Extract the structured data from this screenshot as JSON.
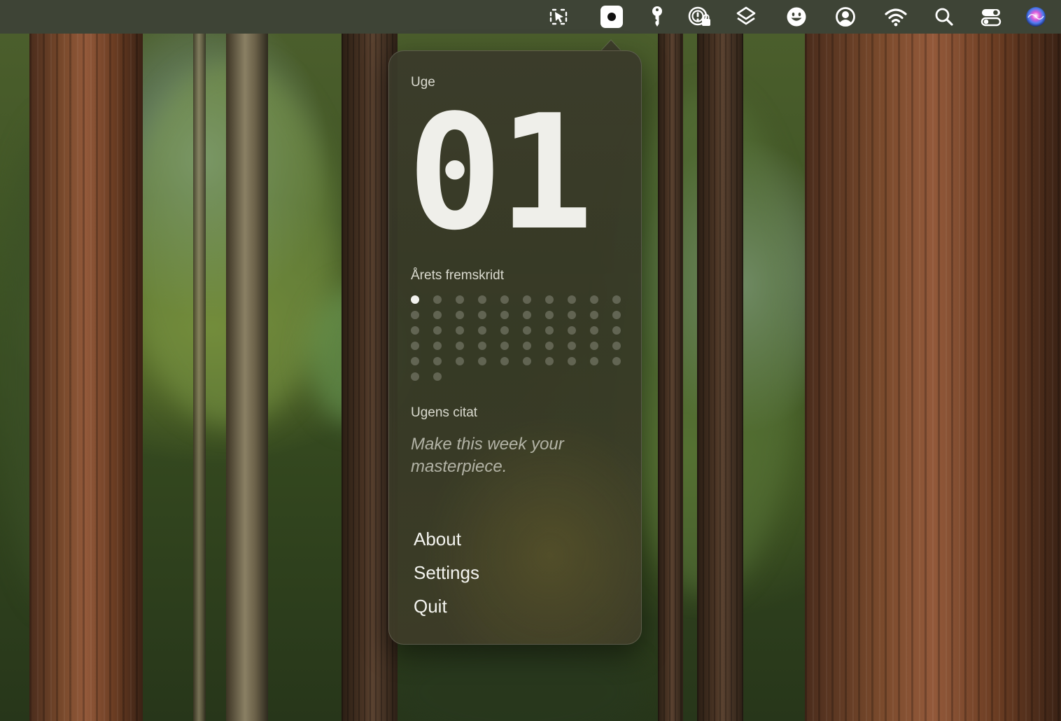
{
  "menubar": {
    "items": [
      {
        "icon": "dev-tool-icon",
        "active": false
      },
      {
        "icon": "record-dot-icon",
        "active": true
      },
      {
        "icon": "key-icon",
        "active": false
      },
      {
        "icon": "alert-lock-icon",
        "active": false
      },
      {
        "icon": "stack-layers-icon",
        "active": false
      },
      {
        "icon": "smiley-icon",
        "active": false
      },
      {
        "icon": "user-circle-icon",
        "active": false
      },
      {
        "icon": "wifi-icon",
        "active": false
      },
      {
        "icon": "search-icon",
        "active": false
      },
      {
        "icon": "control-center-icon",
        "active": false
      },
      {
        "icon": "siri-icon",
        "active": false
      }
    ]
  },
  "popover": {
    "week_label": "Uge",
    "week_number": "01",
    "progress_label": "Årets fremskridt",
    "progress": {
      "total_weeks": 52,
      "filled_weeks": 1
    },
    "quote_label": "Ugens citat",
    "quote": "Make this week your masterpiece.",
    "menu": {
      "about": "About",
      "settings": "Settings",
      "quit": "Quit"
    }
  },
  "colors": {
    "menubar_bg": "#3e4436",
    "popover_text": "#efefea",
    "dot_filled": "#f2f2ee"
  }
}
